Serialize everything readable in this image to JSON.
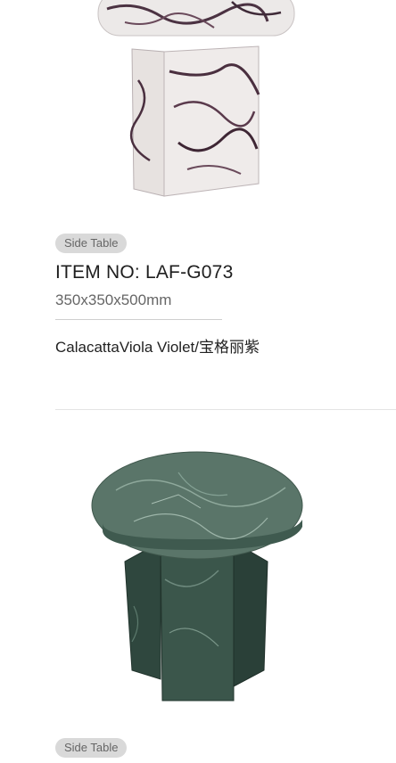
{
  "products": [
    {
      "tag": "Side Table",
      "item_no": "ITEM NO:  LAF-G073",
      "dimensions": "350x350x500mm",
      "material": "CalacattaViola Violet/宝格丽紫",
      "image_icon": "marble-side-table-violet"
    },
    {
      "tag": "Side Table",
      "image_icon": "marble-side-table-green"
    }
  ],
  "colors": {
    "tag_bg": "#d9d9d9",
    "tag_text": "#666666",
    "violet_marble_base": "#ece8e6",
    "violet_veins": "#4a2f3f",
    "green_marble_base": "#4e6b5f"
  }
}
